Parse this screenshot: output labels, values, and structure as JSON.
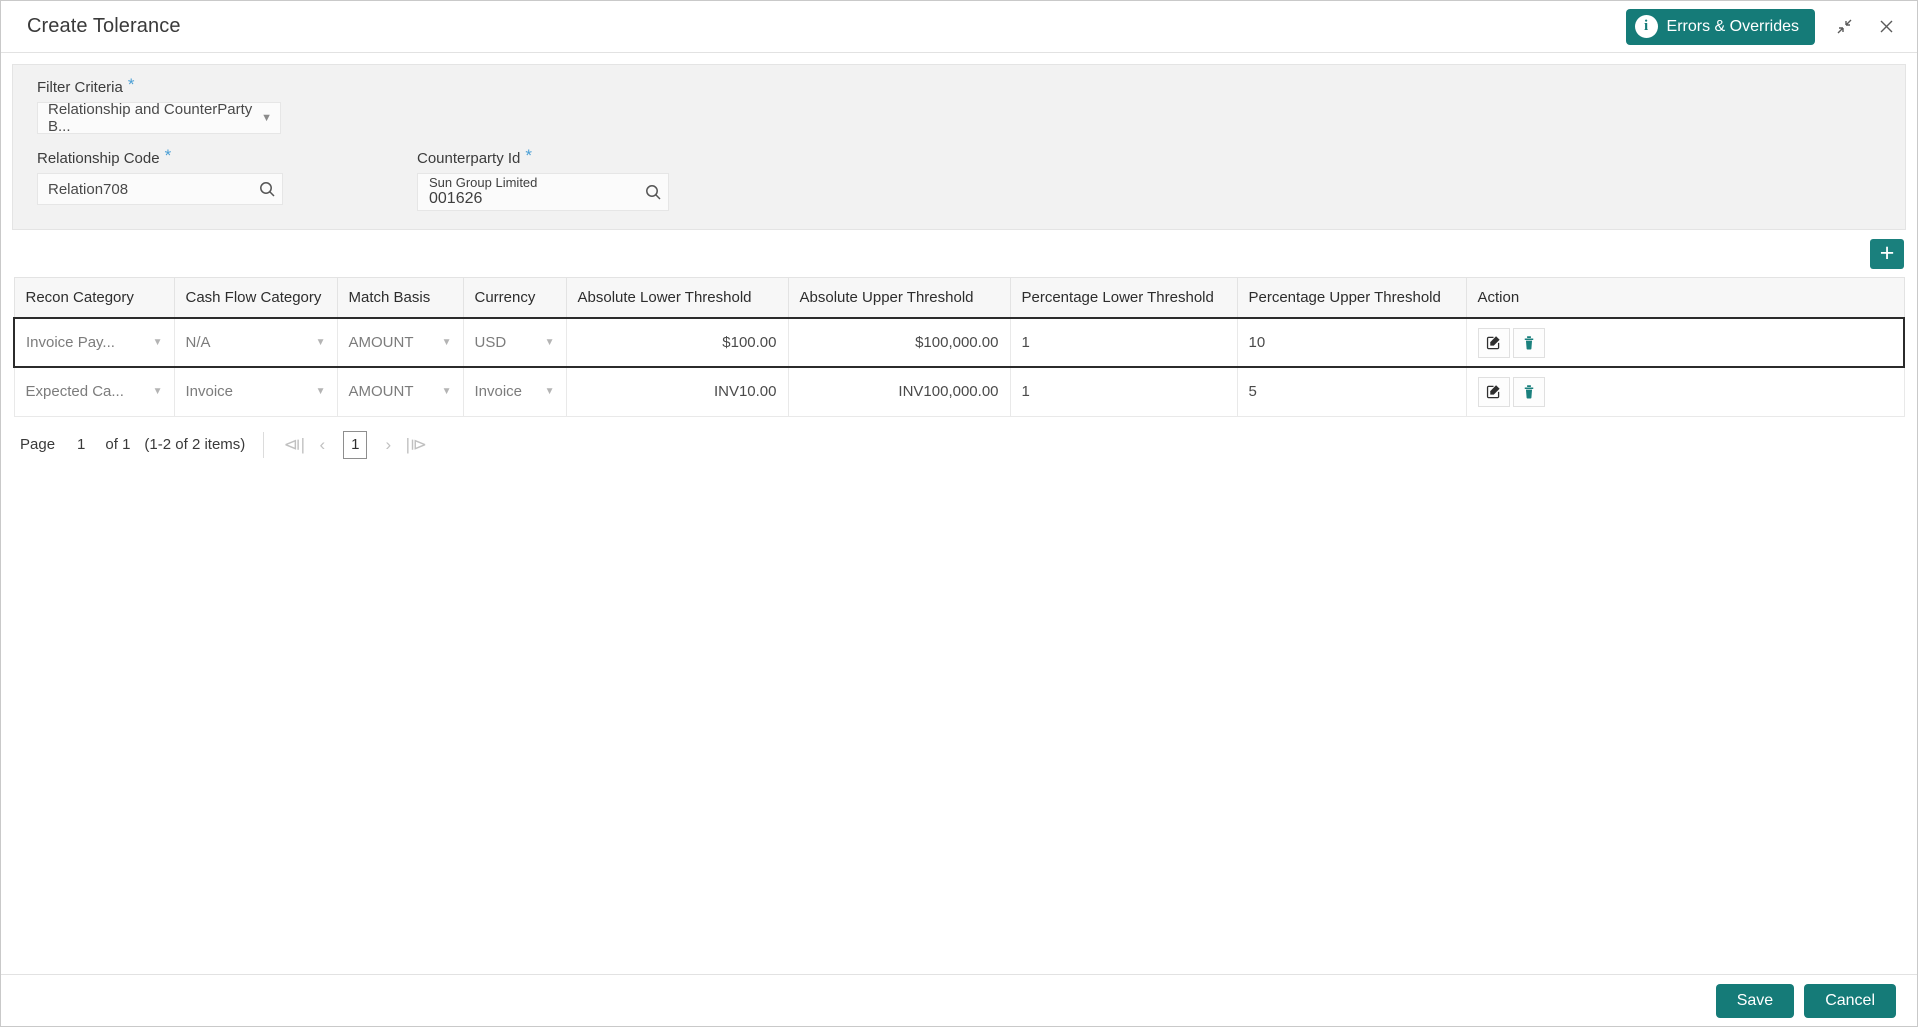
{
  "window": {
    "title": "Create Tolerance",
    "errors_button": "Errors & Overrides",
    "info_glyph": "i",
    "minimize_icon": "collapse-icon",
    "close_icon": "close-icon"
  },
  "filter": {
    "filter_criteria": {
      "label": "Filter Criteria",
      "required": "*",
      "value": "Relationship and CounterParty B...",
      "caret": "▼"
    },
    "relationship_code": {
      "label": "Relationship Code",
      "required": "*",
      "value": "Relation708",
      "search_icon": "search-icon"
    },
    "counterparty_id": {
      "label": "Counterparty Id",
      "required": "*",
      "name": "Sun Group Limited",
      "value": "001626",
      "search_icon": "search-icon"
    }
  },
  "toolbar": {
    "add_label": "+"
  },
  "grid": {
    "columns": [
      "Recon Category",
      "Cash Flow Category",
      "Match Basis",
      "Currency",
      "Absolute Lower Threshold",
      "Absolute Upper Threshold",
      "Percentage Lower Threshold",
      "Percentage Upper Threshold",
      "Action"
    ],
    "caret": "▼",
    "rows": [
      {
        "recon_category": "Invoice Pay...",
        "cash_flow_category": "N/A",
        "match_basis": "AMOUNT",
        "currency": "USD",
        "absolute_lower_threshold": "$100.00",
        "absolute_upper_threshold": "$100,000.00",
        "percentage_lower_threshold": "1",
        "percentage_upper_threshold": "10",
        "selected": true
      },
      {
        "recon_category": "Expected Ca...",
        "cash_flow_category": "Invoice",
        "match_basis": "AMOUNT",
        "currency": "Invoice",
        "absolute_lower_threshold": "INV10.00",
        "absolute_upper_threshold": "INV100,000.00",
        "percentage_lower_threshold": "1",
        "percentage_upper_threshold": "5",
        "selected": false
      }
    ]
  },
  "pagination": {
    "page_label": "Page",
    "page_number": "1",
    "of_label": "of 1",
    "items_label": "(1-2 of 2 items)",
    "first": "⧏|",
    "prev": "‹",
    "current": "1",
    "next": "›",
    "last": "|⧐"
  },
  "footer": {
    "save": "Save",
    "cancel": "Cancel"
  }
}
